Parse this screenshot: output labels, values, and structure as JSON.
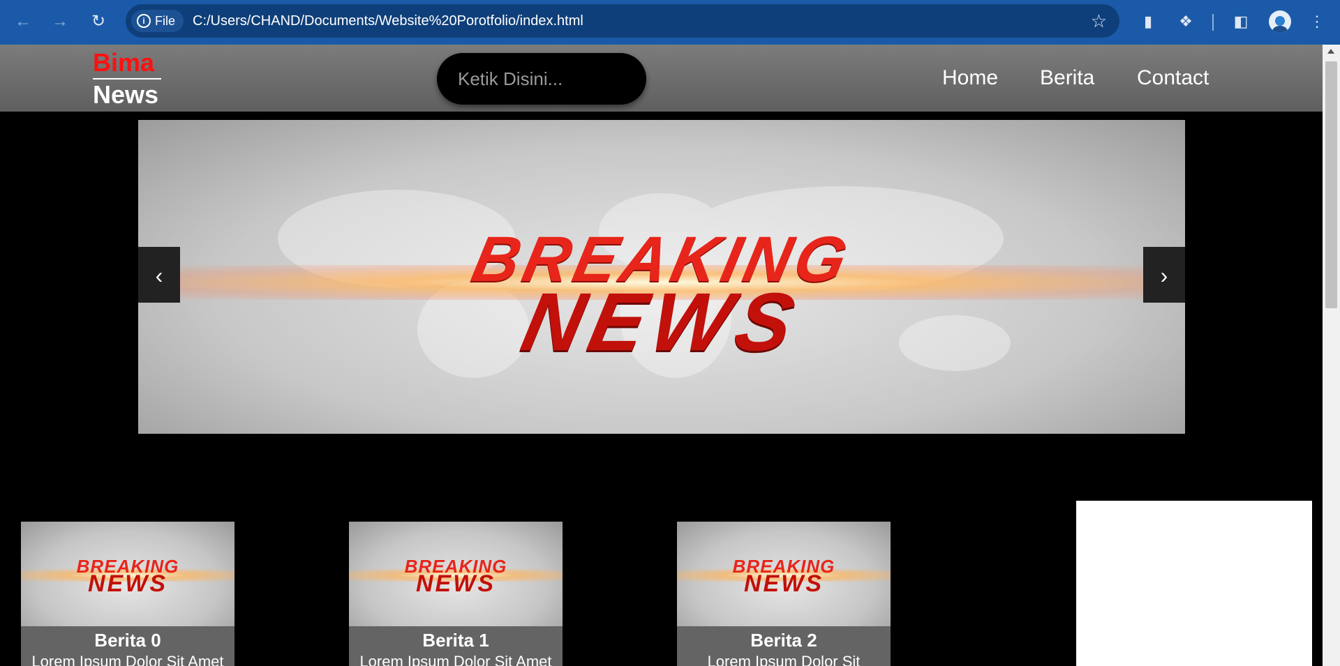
{
  "browser": {
    "back_icon": "arrow-left-icon",
    "forward_icon": "arrow-right-icon",
    "reload_icon": "reload-icon",
    "security_chip": "File",
    "url": "C:/Users/CHAND/Documents/Website%20Porotfolio/index.html",
    "bookmark_icon": "star-icon",
    "extension_icons": [
      "clipboard-icon",
      "puzzle-icon",
      "side-panel-icon"
    ],
    "profile_icon": "avatar",
    "menu_icon": "kebab-menu-icon",
    "accent": "#1a5aa8"
  },
  "header": {
    "brand_top": "Bima",
    "brand_bottom": "News",
    "brand_color": "#ff1010",
    "search_placeholder": "Ketik Disini...",
    "nav": [
      "Home",
      "Berita",
      "Contact"
    ]
  },
  "carousel": {
    "slide_text_line1": "BREAKING",
    "slide_text_line2": "NEWS",
    "prev_label": "‹",
    "next_label": "›"
  },
  "news": [
    {
      "title": "Berita 0",
      "desc": "Lorem Ipsum Dolor Sit Amet",
      "thumb_line1": "BREAKING",
      "thumb_line2": "NEWS"
    },
    {
      "title": "Berita 1",
      "desc": "Lorem Ipsum Dolor Sit Amet",
      "thumb_line1": "BREAKING",
      "thumb_line2": "NEWS"
    },
    {
      "title": "Berita 2",
      "desc": "Lorem Ipsum Dolor Sit",
      "thumb_line1": "BREAKING",
      "thumb_line2": "NEWS"
    }
  ]
}
